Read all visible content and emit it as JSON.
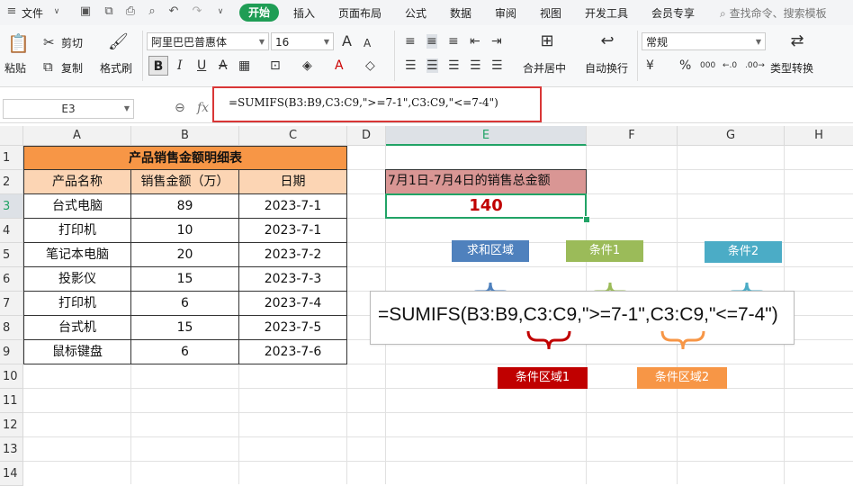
{
  "menubar": {
    "file_label": "文件",
    "tabs": [
      "开始",
      "插入",
      "页面布局",
      "公式",
      "数据",
      "审阅",
      "视图",
      "开发工具",
      "会员专享"
    ],
    "active_tab": "开始",
    "search_placeholder": "查找命令、搜索模板"
  },
  "ribbon": {
    "paste": "粘贴",
    "cut": "剪切",
    "copy": "复制",
    "format_painter": "格式刷",
    "font_name": "阿里巴巴普惠体",
    "font_size": "16",
    "merge_center": "合并居中",
    "auto_wrap": "自动换行",
    "number_format": "常规",
    "type_convert": "类型转换",
    "bold_glyph": "B",
    "italic_glyph": "I",
    "underline_glyph": "U",
    "strike_glyph": "A",
    "grow_glyph": "A",
    "shrink_glyph": "A",
    "currency_glyph": "¥",
    "percent_glyph": "%",
    "thousands_glyph": "000",
    "inc_decimal_glyph": "←.0",
    "dec_decimal_glyph": ".00→"
  },
  "formula_bar": {
    "cell_ref": "E3",
    "fx": "fx",
    "formula": "=SUMIFS(B3:B9,C3:C9,\">=7-1\",C3:C9,\"<=7-4\")"
  },
  "sheet": {
    "columns": [
      "A",
      "B",
      "C",
      "D",
      "E",
      "F",
      "G",
      "H"
    ],
    "rows": [
      "1",
      "2",
      "3",
      "4",
      "5",
      "6",
      "7",
      "8",
      "9",
      "10",
      "11",
      "12",
      "13",
      "14"
    ],
    "table_title": "产品销售金额明细表",
    "headers": [
      "产品名称",
      "销售金额（万）",
      "日期"
    ],
    "data": [
      [
        "台式电脑",
        "89",
        "2023-7-1"
      ],
      [
        "打印机",
        "10",
        "2023-7-1"
      ],
      [
        "笔记本电脑",
        "20",
        "2023-7-2"
      ],
      [
        "投影仪",
        "15",
        "2023-7-3"
      ],
      [
        "打印机",
        "6",
        "2023-7-4"
      ],
      [
        "台式机",
        "15",
        "2023-7-5"
      ],
      [
        "鼠标键盘",
        "6",
        "2023-7-6"
      ]
    ],
    "e2_label": "7月1日-7月4日的销售总金额",
    "e3_value": "140"
  },
  "annotation": {
    "formula": "=SUMIFS(B3:B9,C3:C9,\">=7-1\",C3:C9,\"<=7-4\")",
    "sum_range_label": "求和区域",
    "criteria1_label": "条件1",
    "criteria2_label": "条件2",
    "criteria_range1_label": "条件区域1",
    "criteria_range2_label": "条件区域2",
    "colors": {
      "sum_range": "#4f81bd",
      "criteria1": "#9bbb59",
      "criteria2": "#4bacc6",
      "criteria_range1": "#c00000",
      "criteria_range2": "#f79646"
    }
  },
  "colors": {
    "accent": "#1f9d55",
    "title_fill": "#f79646",
    "header_fill": "#fcd5b4",
    "e2_fill": "#d99694",
    "highlight_border": "#d93636",
    "result_color": "#c00000"
  }
}
